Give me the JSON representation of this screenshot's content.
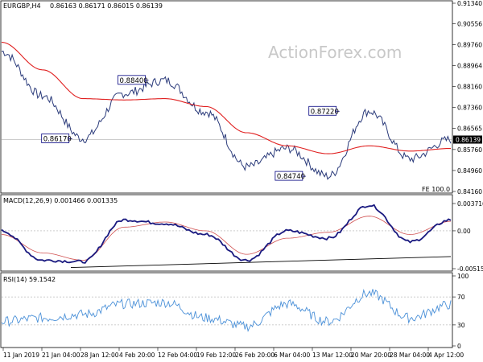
{
  "header": {
    "symbol": "EURGBP,H4",
    "ohlc": "0.86163 0.86171 0.86015 0.86139"
  },
  "watermark": "ActionForex.com",
  "fe_label": "FE 100.0",
  "colors": {
    "price": "#2a3a7a",
    "ma": "#e02020",
    "macd": "#1a1a80",
    "signal": "#d05050",
    "rsi": "#4a90d8",
    "box_border": "#00007f",
    "current_bg": "#000000"
  },
  "price_panel": {
    "ticks": [
      "0.91340",
      "0.90556",
      "0.89760",
      "0.88964",
      "0.88160",
      "0.87360",
      "0.86565",
      "0.85760",
      "0.84960",
      "0.84160"
    ],
    "current": "0.86139",
    "annotations": [
      {
        "name": "annot-088400",
        "label": "0.88400",
        "value": 0.884,
        "x": 0.32
      },
      {
        "name": "annot-086170",
        "label": "0.86170",
        "value": 0.8617,
        "x": 0.15
      },
      {
        "name": "annot-087220",
        "label": "0.87220",
        "value": 0.8722,
        "x": 0.745
      },
      {
        "name": "annot-084740",
        "label": "0.84740",
        "value": 0.8474,
        "x": 0.67
      }
    ]
  },
  "macd_panel": {
    "label": "MACD(12,26,9) 0.001466 0.001335",
    "ticks": [
      "0.003716",
      "0.00",
      "-0.005152"
    ]
  },
  "rsi_panel": {
    "label": "RSI(14) 59.1542",
    "ticks": [
      "100",
      "70",
      "30",
      "0"
    ]
  },
  "time_axis": [
    "11 Jan 2019",
    "21 Jan 04:00",
    "28 Jan 12:00",
    "4 Feb 20:00",
    "12 Feb 04:00",
    "19 Feb 12:00",
    "26 Feb 20:00",
    "6 Mar 04:00",
    "13 Mar 12:00",
    "20 Mar 20:00",
    "28 Mar 04:00",
    "4 Apr 12:00"
  ],
  "chart_data": [
    {
      "type": "line",
      "title": "EURGBP,H4",
      "ylim": [
        0.8416,
        0.9134
      ],
      "x": [
        "11 Jan 2019",
        "21 Jan 04:00",
        "28 Jan 12:00",
        "4 Feb 20:00",
        "12 Feb 04:00",
        "19 Feb 12:00",
        "26 Feb 20:00",
        "6 Mar 04:00",
        "13 Mar 12:00",
        "20 Mar 20:00",
        "28 Mar 04:00",
        "4 Apr 12:00"
      ],
      "series": [
        {
          "values": [
            0.895,
            0.878,
            0.8617,
            0.879,
            0.884,
            0.872,
            0.851,
            0.858,
            0.8474,
            0.8722,
            0.854,
            0.8614
          ]
        },
        {
          "values": [
            0.8985,
            0.888,
            0.877,
            0.8765,
            0.877,
            0.874,
            0.864,
            0.859,
            0.856,
            0.859,
            0.857,
            0.858
          ]
        }
      ]
    },
    {
      "type": "line",
      "title": "MACD(12,26,9) 0.001466 0.001335",
      "ylim": [
        -0.005152,
        0.003716
      ],
      "x": [
        "11 Jan 2019",
        "21 Jan 04:00",
        "28 Jan 12:00",
        "4 Feb 20:00",
        "12 Feb 04:00",
        "19 Feb 12:00",
        "26 Feb 20:00",
        "6 Mar 04:00",
        "13 Mar 12:00",
        "20 Mar 20:00",
        "28 Mar 04:00",
        "4 Apr 12:00"
      ],
      "series": [
        {
          "values": [
            0.0,
            -0.004,
            -0.0042,
            0.0015,
            0.001,
            -0.0005,
            -0.004,
            0.0,
            -0.001,
            0.0035,
            -0.0015,
            0.0015
          ]
        },
        {
          "values": [
            -0.0005,
            -0.003,
            -0.004,
            0.0005,
            0.0012,
            0.0,
            -0.0032,
            -0.001,
            -0.0002,
            0.002,
            -0.0005,
            0.0013
          ]
        }
      ]
    },
    {
      "type": "line",
      "title": "RSI(14) 59.1542",
      "ylim": [
        0,
        100
      ],
      "x": [
        "11 Jan 2019",
        "21 Jan 04:00",
        "28 Jan 12:00",
        "4 Feb 20:00",
        "12 Feb 04:00",
        "19 Feb 12:00",
        "26 Feb 20:00",
        "6 Mar 04:00",
        "13 Mar 12:00",
        "20 Mar 20:00",
        "28 Mar 04:00",
        "4 Apr 12:00"
      ],
      "series": [
        {
          "values": [
            35,
            40,
            45,
            60,
            62,
            40,
            28,
            60,
            35,
            75,
            40,
            59
          ]
        }
      ]
    }
  ]
}
